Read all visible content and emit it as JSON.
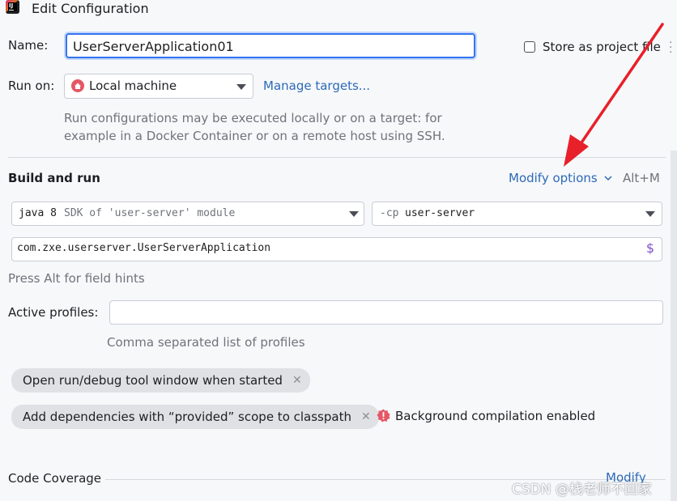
{
  "window": {
    "title": "Edit Configuration"
  },
  "name_row": {
    "label": "Name:",
    "value": "UserServerApplication01"
  },
  "store": {
    "label": "Store as project file"
  },
  "run_on": {
    "label": "Run on:",
    "selected": "Local machine",
    "manage_link": "Manage targets...",
    "description_line1": "Run configurations may be executed locally or on a target: for",
    "description_line2": "example in a Docker Container or on a remote host using SSH."
  },
  "build_and_run": {
    "heading": "Build and run",
    "modify_options": "Modify options",
    "shortcut": "Alt+M",
    "sdk_keyword": "java 8",
    "sdk_suffix": "SDK of 'user-server' module",
    "cp_prefix": "-cp",
    "cp_value": "user-server",
    "main_class": "com.zxe.userserver.UserServerApplication",
    "field_hint": "Press Alt for field hints"
  },
  "profiles": {
    "label": "Active profiles:",
    "value": "",
    "hint": "Comma separated list of profiles"
  },
  "chips": [
    {
      "label": "Open run/debug tool window when started"
    },
    {
      "label": "Add dependencies with “provided” scope to classpath"
    }
  ],
  "warning": {
    "text": "Background compilation enabled"
  },
  "code_coverage": {
    "label": "Code Coverage",
    "modify": "Modify"
  },
  "watermark": "CSDN @栈老师不回家",
  "colors": {
    "accent": "#3574f0",
    "link": "#2c6ab7",
    "arrow": "#e8202a",
    "warning": "#e55765"
  }
}
